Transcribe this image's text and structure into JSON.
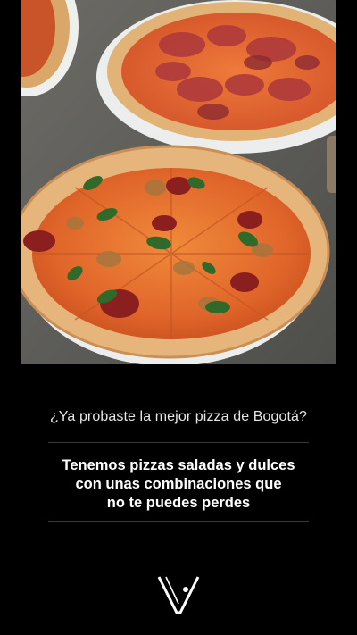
{
  "question": "¿Ya probaste la mejor pizza de Bogotá?",
  "headline_lines": [
    "Tenemos pizzas saladas y dulces",
    "con unas combinaciones que",
    "no te puedes perdes"
  ],
  "colors": {
    "background": "#000000",
    "text": "#ffffff",
    "muted_text": "#e6e6e6",
    "divider": "#3a3a3a"
  },
  "photo_subject": "pizzas-on-table",
  "logo_icon": "brand-v-logo-icon"
}
